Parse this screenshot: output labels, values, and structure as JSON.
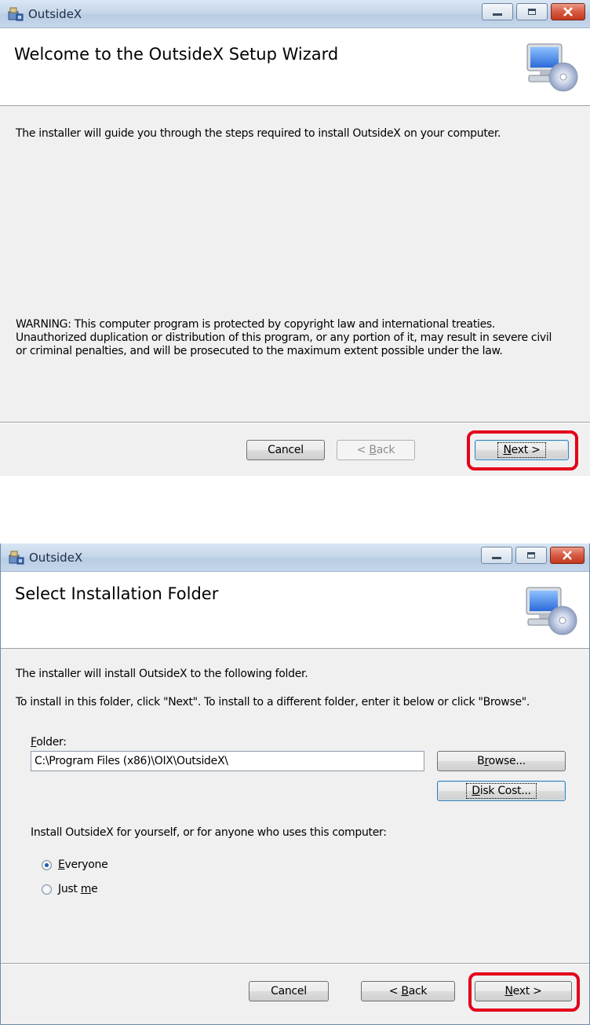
{
  "window1": {
    "title": "OutsideX",
    "heading": "Welcome to the OutsideX Setup Wizard",
    "intro": "The installer will guide you through the steps required to install OutsideX on your computer.",
    "warning_lines": [
      "WARNING: This computer program is protected by copyright law and international treaties.",
      "Unauthorized duplication or distribution of this program, or any portion of it, may result in severe civil",
      "or criminal penalties, and will be prosecuted to the maximum extent possible under the law."
    ],
    "buttons": {
      "cancel": "Cancel",
      "back_prefix": "< ",
      "back_key": "B",
      "back_rest": "ack",
      "next_key": "N",
      "next_rest": "ext >"
    },
    "back_enabled": false
  },
  "window2": {
    "title": "OutsideX",
    "heading": "Select Installation Folder",
    "line1": "The installer will install OutsideX to the following folder.",
    "line2": "To install in this folder, click \"Next\". To install to a different folder, enter it below or click \"Browse\".",
    "folder_label_key": "F",
    "folder_label_rest": "older:",
    "folder_value": "C:\\Program Files (x86)\\OIX\\OutsideX\\",
    "browse_pre": "B",
    "browse_key": "r",
    "browse_rest": "owse...",
    "diskcost_key": "D",
    "diskcost_rest": "isk Cost...",
    "install_for": "Install OutsideX for yourself, or for anyone who uses this computer:",
    "radio_everyone_key": "E",
    "radio_everyone_rest": "veryone",
    "radio_justme_pre": "Just ",
    "radio_justme_key": "m",
    "radio_justme_rest": "e",
    "selected_option": "Everyone",
    "buttons": {
      "cancel": "Cancel",
      "back_prefix": "< ",
      "back_key": "B",
      "back_rest": "ack",
      "next_key": "N",
      "next_rest": "ext >"
    }
  },
  "colors": {
    "highlight": "#e3001b",
    "title_bar": "#c6d7ea",
    "close_button": "#d65a41"
  },
  "icons": [
    "installer-app-icon",
    "minimize-icon",
    "maximize-icon",
    "close-icon",
    "computer-cd-icon"
  ]
}
